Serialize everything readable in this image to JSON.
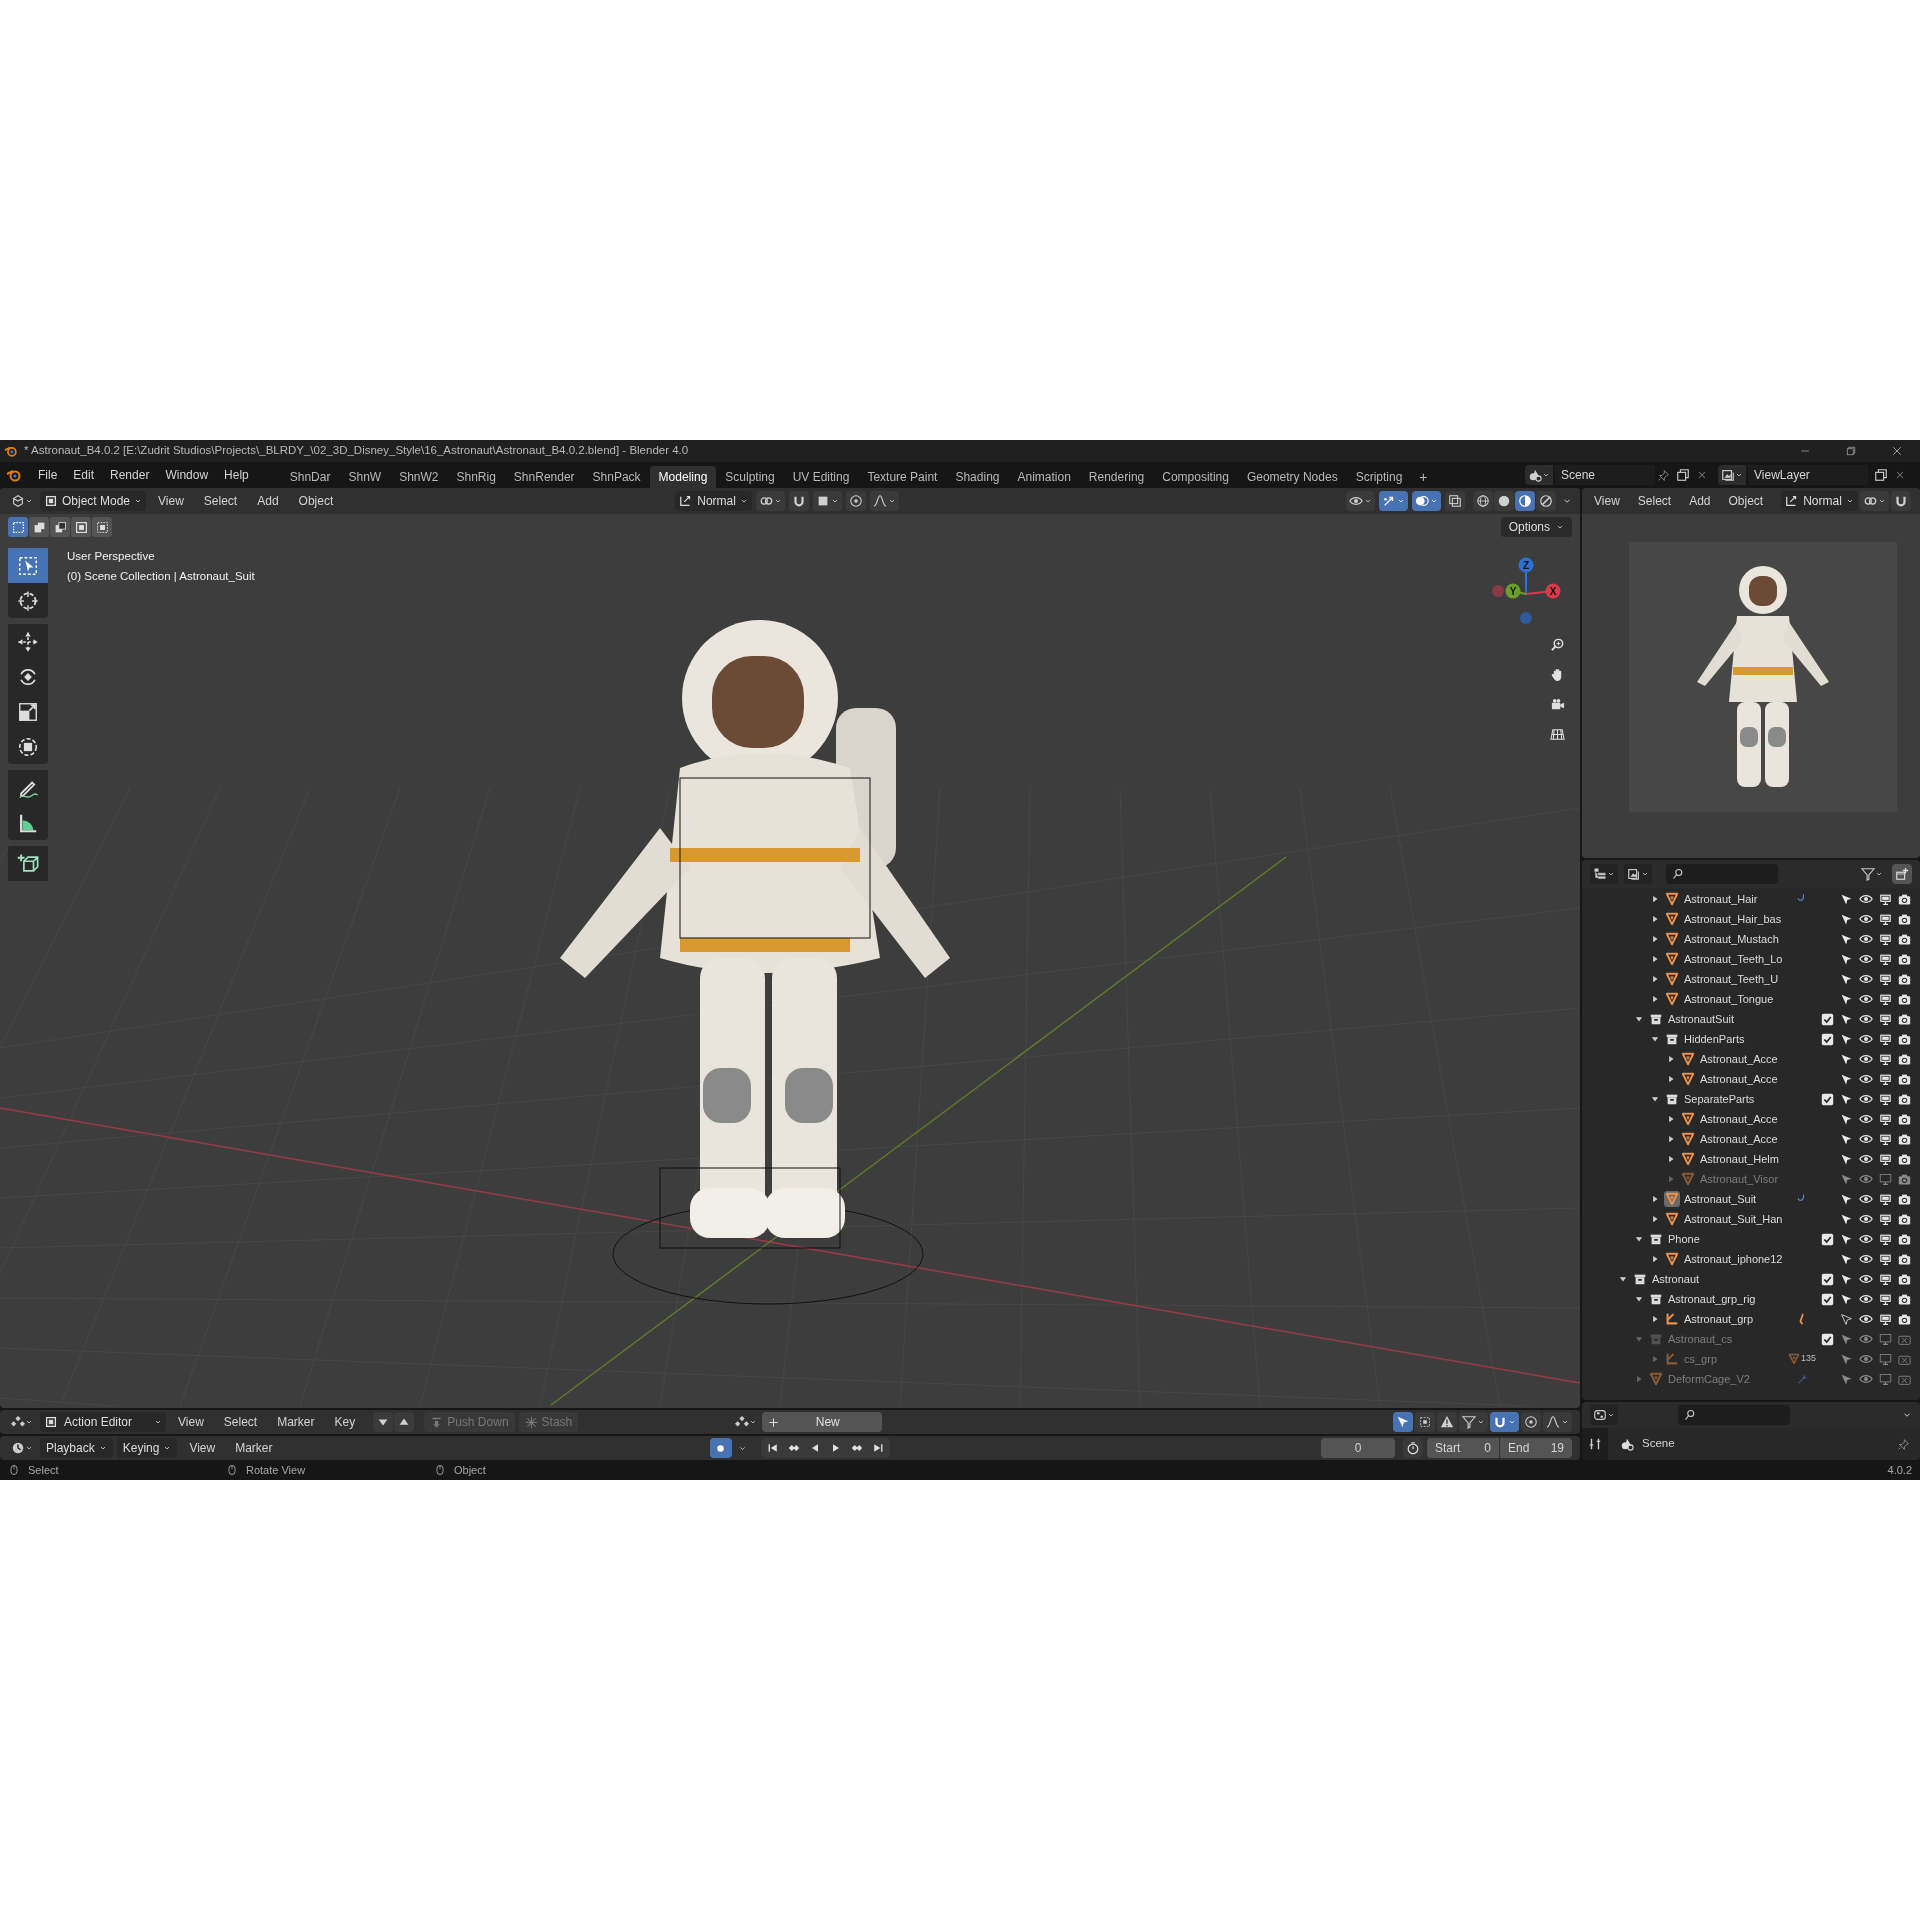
{
  "window": {
    "title": "* Astronaut_B4.0.2 [E:\\Zudrit Studios\\Projects\\_BLRDY_\\02_3D_Disney_Style\\16_Astronaut\\Astronaut_B4.0.2.blend] - Blender 4.0"
  },
  "menu": [
    "File",
    "Edit",
    "Render",
    "Window",
    "Help"
  ],
  "workspaces": [
    {
      "label": "ShnDar",
      "selected": false
    },
    {
      "label": "ShnW",
      "selected": false
    },
    {
      "label": "ShnW2",
      "selected": false
    },
    {
      "label": "ShnRig",
      "selected": false
    },
    {
      "label": "ShnRender",
      "selected": false
    },
    {
      "label": "ShnPack",
      "selected": false
    },
    {
      "label": "Modeling",
      "selected": true
    },
    {
      "label": "Sculpting",
      "selected": false
    },
    {
      "label": "UV Editing",
      "selected": false
    },
    {
      "label": "Texture Paint",
      "selected": false
    },
    {
      "label": "Shading",
      "selected": false
    },
    {
      "label": "Animation",
      "selected": false
    },
    {
      "label": "Rendering",
      "selected": false
    },
    {
      "label": "Compositing",
      "selected": false
    },
    {
      "label": "Geometry Nodes",
      "selected": false
    },
    {
      "label": "Scripting",
      "selected": false
    }
  ],
  "add_workspace": "+",
  "scene": "Scene",
  "view_layer": "ViewLayer",
  "viewport": {
    "mode": "Object Mode",
    "menus": [
      "View",
      "Select",
      "Add",
      "Object"
    ],
    "orientation": "Normal",
    "shading": [
      {
        "kind": "wireframe",
        "selected": false
      },
      {
        "kind": "solid",
        "selected": false
      },
      {
        "kind": "material",
        "selected": true
      },
      {
        "kind": "rendered",
        "selected": false
      }
    ],
    "gizmos_on": true,
    "overlays_on": true,
    "select_modes": [
      {
        "kind": "new",
        "selected": true
      },
      {
        "kind": "extend",
        "selected": false
      },
      {
        "kind": "subtract",
        "selected": false
      },
      {
        "kind": "invert",
        "selected": false
      },
      {
        "kind": "intersect",
        "selected": false
      }
    ],
    "options": "Options",
    "info": [
      "User Perspective",
      "(0) Scene Collection | Astronaut_Suit"
    ],
    "tools": [
      {
        "kind": "select",
        "selected": true
      },
      {
        "kind": "cursor",
        "selected": false
      },
      {
        "kind": "move",
        "selected": false
      },
      {
        "kind": "rotate",
        "selected": false
      },
      {
        "kind": "scale",
        "selected": false
      },
      {
        "kind": "transform",
        "selected": false
      },
      {
        "kind": "annotate",
        "selected": false
      },
      {
        "kind": "measure",
        "selected": false
      },
      {
        "kind": "add-cube",
        "selected": false
      }
    ],
    "gizmo": [
      {
        "label": "Z",
        "color": "#2f6fd6"
      },
      {
        "label": "Y",
        "color": "#6a9f2a"
      },
      {
        "label": "X",
        "color": "#d8394b"
      }
    ]
  },
  "preview_editor": {
    "menus": [
      "View",
      "Select",
      "Add",
      "Object"
    ],
    "orientation": "Normal"
  },
  "outliner": {
    "tree": [
      {
        "children": [
          {
            "children": [
              {
                "label": "Astronaut_Hair",
                "kind": "mesh",
                "expanded": false,
                "disabled": false,
                "selectable": true,
                "viewport": true,
                "render": true,
                "active": false,
                "badge": {
                  "kind": "hook"
                }
              },
              {
                "label": "Astronaut_Hair_bas",
                "kind": "mesh",
                "expanded": false,
                "disabled": false,
                "selectable": true,
                "viewport": true,
                "render": true,
                "active": false
              },
              {
                "label": "Astronaut_Mustach",
                "kind": "mesh",
                "expanded": false,
                "disabled": false,
                "selectable": true,
                "viewport": true,
                "render": true,
                "active": false
              },
              {
                "label": "Astronaut_Teeth_Lo",
                "kind": "mesh",
                "expanded": false,
                "disabled": false,
                "selectable": true,
                "viewport": true,
                "render": true,
                "active": false
              },
              {
                "label": "Astronaut_Teeth_U",
                "kind": "mesh",
                "expanded": false,
                "disabled": false,
                "selectable": true,
                "viewport": true,
                "render": true,
                "active": false
              },
              {
                "label": "Astronaut_Tongue",
                "kind": "mesh",
                "expanded": false,
                "disabled": false,
                "selectable": true,
                "viewport": true,
                "render": true,
                "active": false
              }
            ]
          },
          {
            "label": "AstronautSuit",
            "kind": "collection",
            "expanded": true,
            "checked": true,
            "disabled": false,
            "selectable": true,
            "viewport": true,
            "render": true,
            "active": false,
            "children": [
              {
                "label": "HiddenParts",
                "kind": "collection",
                "expanded": true,
                "checked": true,
                "disabled": false,
                "selectable": true,
                "viewport": true,
                "render": true,
                "active": false,
                "children": [
                  {
                    "label": "Astronaut_Acce",
                    "kind": "mesh",
                    "expanded": false,
                    "disabled": false,
                    "selectable": true,
                    "viewport": true,
                    "render": true,
                    "active": false
                  },
                  {
                    "label": "Astronaut_Acce",
                    "kind": "mesh",
                    "expanded": false,
                    "disabled": false,
                    "selectable": true,
                    "viewport": true,
                    "render": true,
                    "active": false
                  }
                ]
              },
              {
                "label": "SeparateParts",
                "kind": "collection",
                "expanded": true,
                "checked": true,
                "disabled": false,
                "selectable": true,
                "viewport": true,
                "render": true,
                "active": false,
                "children": [
                  {
                    "label": "Astronaut_Acce",
                    "kind": "mesh",
                    "expanded": false,
                    "disabled": false,
                    "selectable": true,
                    "viewport": true,
                    "render": true,
                    "active": false
                  },
                  {
                    "label": "Astronaut_Acce",
                    "kind": "mesh",
                    "expanded": false,
                    "disabled": false,
                    "selectable": true,
                    "viewport": true,
                    "render": true,
                    "active": false
                  },
                  {
                    "label": "Astronaut_Helm",
                    "kind": "mesh",
                    "expanded": false,
                    "disabled": false,
                    "selectable": true,
                    "viewport": true,
                    "render": true,
                    "active": false
                  },
                  {
                    "label": "Astronaut_Visor",
                    "kind": "mesh",
                    "expanded": false,
                    "disabled": true,
                    "selectable": true,
                    "viewport": false,
                    "render": true,
                    "active": false
                  }
                ]
              },
              {
                "label": "Astronaut_Suit",
                "kind": "mesh",
                "expanded": false,
                "disabled": false,
                "selectable": true,
                "viewport": true,
                "render": true,
                "active": true,
                "badge": {
                  "kind": "hook"
                }
              },
              {
                "label": "Astronaut_Suit_Han",
                "kind": "mesh",
                "expanded": false,
                "disabled": false,
                "selectable": true,
                "viewport": true,
                "render": true,
                "active": false
              }
            ]
          },
          {
            "label": "Phone",
            "kind": "collection",
            "expanded": true,
            "checked": true,
            "disabled": false,
            "selectable": true,
            "viewport": true,
            "render": true,
            "active": false,
            "children": [
              {
                "label": "Astronaut_iphone12",
                "kind": "mesh",
                "expanded": false,
                "disabled": false,
                "selectable": true,
                "viewport": true,
                "render": true,
                "active": false
              }
            ]
          }
        ]
      },
      {
        "label": "Astronaut",
        "kind": "collection",
        "expanded": true,
        "checked": true,
        "disabled": false,
        "selectable": true,
        "viewport": true,
        "render": true,
        "active": false,
        "children": [
          {
            "label": "Astronaut_grp_rig",
            "kind": "collection",
            "expanded": true,
            "checked": true,
            "disabled": false,
            "selectable": true,
            "viewport": true,
            "render": true,
            "active": false,
            "children": [
              {
                "label": "Astronaut_grp",
                "kind": "armature",
                "expanded": false,
                "disabled": false,
                "selectable": false,
                "viewport": true,
                "render": true,
                "active": false,
                "badge": {
                  "kind": "pose"
                }
              }
            ]
          },
          {
            "label": "Astronaut_cs",
            "kind": "collection",
            "expanded": true,
            "checked": true,
            "disabled": true,
            "selectable": true,
            "viewport": false,
            "render": false,
            "active": false,
            "children": [
              {
                "label": "cs_grp",
                "kind": "armature",
                "expanded": false,
                "disabled": true,
                "selectable": true,
                "viewport": false,
                "render": false,
                "active": false,
                "badge": {
                  "kind": "count",
                  "text": "135"
                }
              }
            ]
          },
          {
            "label": "DeformCage_V2",
            "kind": "mesh",
            "expanded": false,
            "disabled": true,
            "selectable": true,
            "viewport": false,
            "render": false,
            "active": false,
            "badge": {
              "kind": "wrench"
            }
          }
        ]
      }
    ]
  },
  "properties": {
    "scene": "Scene"
  },
  "action_editor": {
    "mode": "Action Editor",
    "menus": [
      "View",
      "Select",
      "Marker",
      "Key"
    ],
    "push_down": "Push Down",
    "stash": "Stash",
    "new": "New"
  },
  "timeline": {
    "dropdowns": [
      "Playback",
      "Keying"
    ],
    "menus": [
      "View",
      "Marker"
    ],
    "auto_keying": true,
    "current_frame": "0",
    "start_label": "Start",
    "start": "0",
    "end_label": "End",
    "end": "19"
  },
  "status_bar": {
    "hints": [
      "Select",
      "Rotate View",
      "Object"
    ],
    "version": "4.0.2"
  }
}
